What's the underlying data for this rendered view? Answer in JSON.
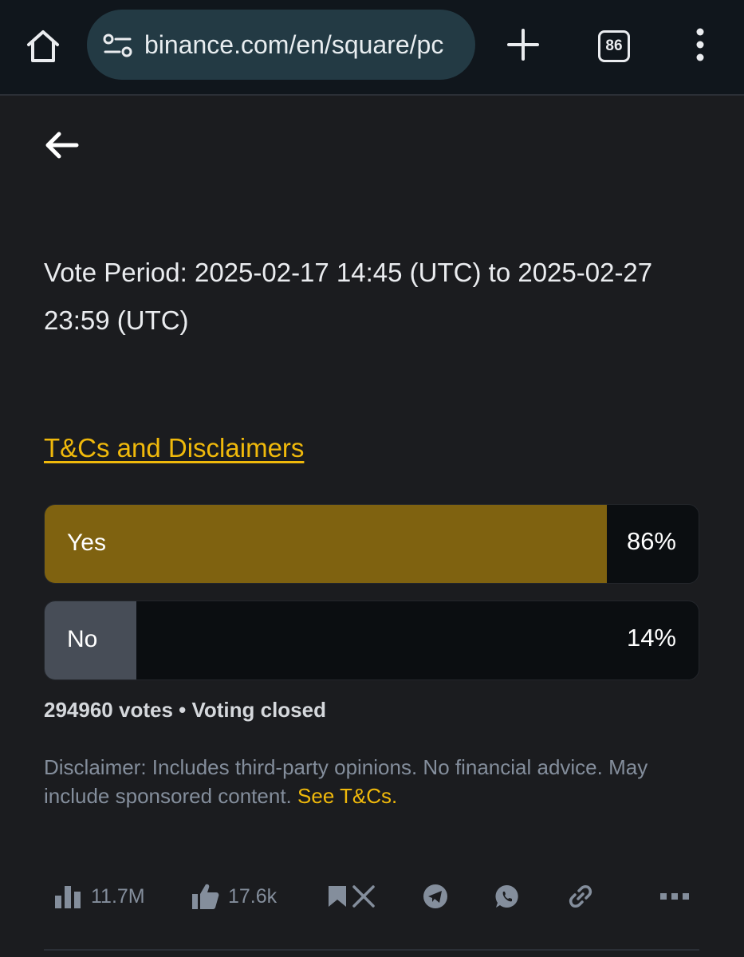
{
  "browser": {
    "url": "binance.com/en/square/pc",
    "tab_count": "86"
  },
  "post": {
    "vote_period": "Vote Period: 2025-02-17 14:45 (UTC) to 2025-02-27 23:59 (UTC)",
    "tcs_link": "T&Cs and Disclaimers"
  },
  "poll": {
    "options": [
      {
        "label": "Yes",
        "percent_text": "86%",
        "percent": 86,
        "color": "#7f6210"
      },
      {
        "label": "No",
        "percent_text": "14%",
        "percent": 14,
        "color": "#474d57"
      }
    ],
    "votes_line": "294960 votes • Voting closed"
  },
  "disclaimer": {
    "text": "Disclaimer: Includes third-party opinions. No financial advice. May include sponsored content.",
    "link": "See T&Cs."
  },
  "actions": {
    "views": "11.7M",
    "likes": "17.6k"
  },
  "colors": {
    "accent": "#f0b90b",
    "background": "#1b1c1f",
    "muted_text": "#848e9c"
  }
}
